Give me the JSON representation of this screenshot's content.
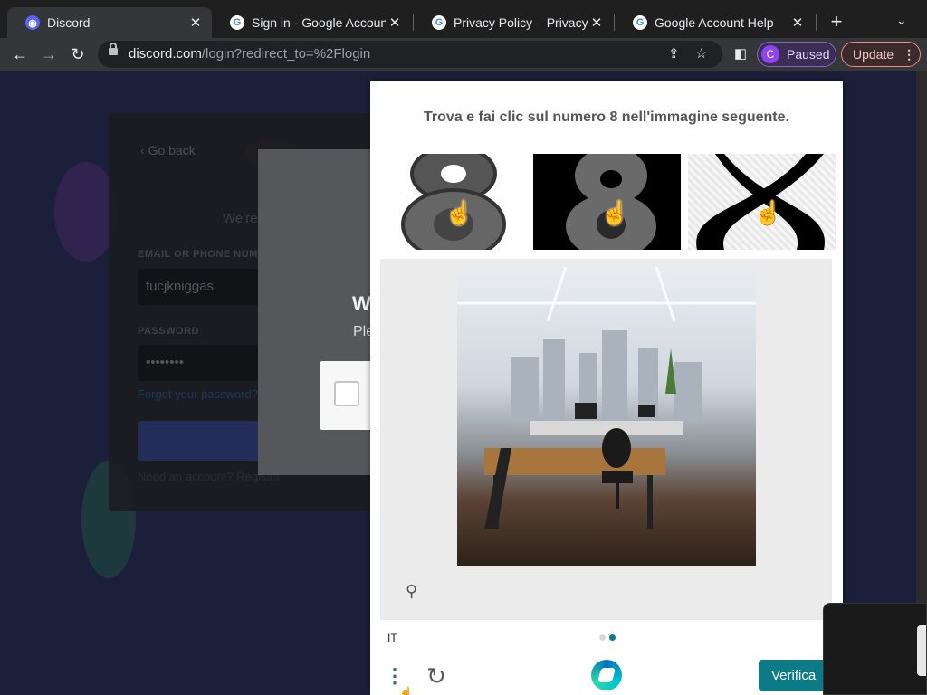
{
  "browser": {
    "tabs": [
      {
        "title": "Discord",
        "favicon": "discord-icon",
        "active": true
      },
      {
        "title": "Sign in - Google Accounts",
        "favicon": "google-icon",
        "active": false
      },
      {
        "title": "Privacy Policy – Privacy & Te",
        "favicon": "google-icon",
        "active": false
      },
      {
        "title": "Google Account Help",
        "favicon": "google-icon",
        "active": false
      }
    ],
    "new_tab": "+",
    "url_host": "discord.com",
    "url_path": "/login?redirect_to=%2Flogin",
    "profile_initial": "C",
    "profile_status": "Paused",
    "update_label": "Update"
  },
  "discord": {
    "go_back": "Go back",
    "welcome_sub": "We're",
    "email_label": "EMAIL OR PHONE NUMBER",
    "email_value": "fucjkniggas",
    "password_label": "PASSWORD",
    "password_value": "••••••••",
    "forgot": "Forgot your password?",
    "register": "Need an account? Register",
    "modal_title": "W",
    "modal_sub": "Ple"
  },
  "captcha": {
    "prompt": "Trova e fai clic sul numero 8 nell'immagine seguente.",
    "example_glyph": "8",
    "language": "IT",
    "verify_label": "Verifica",
    "colors": {
      "accent": "#0c7b86",
      "dot_active": "#0c7b86",
      "dot_inactive": "#d8d8d8"
    }
  }
}
